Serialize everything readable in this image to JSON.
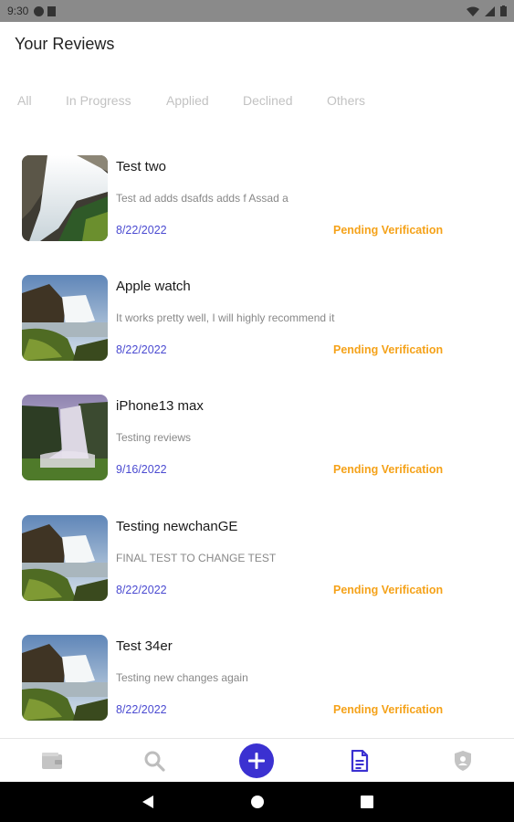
{
  "status_bar": {
    "time": "9:30"
  },
  "header": {
    "title": "Your Reviews"
  },
  "tabs": [
    {
      "label": "All"
    },
    {
      "label": "In Progress"
    },
    {
      "label": "Applied"
    },
    {
      "label": "Declined"
    },
    {
      "label": "Others"
    }
  ],
  "reviews": [
    {
      "title": "Test two",
      "description": "Test ad adds dsafds adds f Assad a",
      "date": "8/22/2022",
      "status": "Pending Verification",
      "image": "waterfall-closeup"
    },
    {
      "title": "Apple watch",
      "description": "It works pretty well, I will highly recommend it",
      "date": "8/22/2022",
      "status": "Pending Verification",
      "image": "waterfall-rocks"
    },
    {
      "title": "iPhone13 max",
      "description": "Testing reviews",
      "date": "9/16/2022",
      "status": "Pending Verification",
      "image": "waterfall-misty"
    },
    {
      "title": "Testing newchanGE",
      "description": "FINAL TEST  TO CHANGE TEST",
      "date": "8/22/2022",
      "status": "Pending Verification",
      "image": "waterfall-rocks"
    },
    {
      "title": "Test 34er",
      "description": "Testing new changes again",
      "date": "8/22/2022",
      "status": "Pending Verification",
      "image": "waterfall-rocks"
    }
  ],
  "bottom_nav": {
    "items": [
      {
        "icon": "wallet-icon",
        "active": false
      },
      {
        "icon": "search-icon",
        "active": false
      },
      {
        "icon": "plus-icon",
        "active": false
      },
      {
        "icon": "document-icon",
        "active": true
      },
      {
        "icon": "shield-icon",
        "active": false
      }
    ]
  },
  "colors": {
    "accent": "#3b31d1",
    "date": "#4b4bd1",
    "status_pending": "#f5a219",
    "tab_inactive": "#c2c2c2"
  }
}
